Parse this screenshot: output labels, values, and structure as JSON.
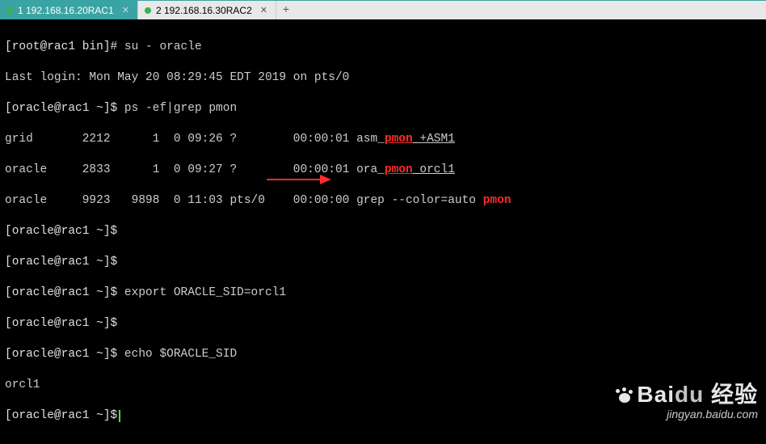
{
  "tabs": [
    {
      "label": "1 192.168.16.20RAC1",
      "active": true
    },
    {
      "label": "2 192.168.16.30RAC2",
      "active": false
    }
  ],
  "lines": {
    "l0_prompt": "[root@rac1 bin]#",
    "l0_cmd": " su - oracle",
    "l1": "Last login: Mon May 20 08:29:45 EDT 2019 on pts/0",
    "l2_prompt": "[oracle@rac1 ~]$",
    "l2_cmd": " ps -ef|grep pmon",
    "l3_pre": "grid       2212      1  0 09:26 ?        00:00:01 asm_",
    "l3_hi": "pmon",
    "l3_post": "_+ASM1",
    "l4_pre": "oracle     2833      1  0 09:27 ?        00:00:01 ora_",
    "l4_hi": "pmon",
    "l4_post": "_orcl1",
    "l5_pre": "oracle     9923   9898  0 11:03 pts/0    00:00:00 grep --color=auto ",
    "l5_hi": "pmon",
    "l6_prompt": "[oracle@rac1 ~]$",
    "l7_prompt": "[oracle@rac1 ~]$",
    "l8_prompt": "[oracle@rac1 ~]$",
    "l8_cmd": " export ORACLE_SID=orcl1",
    "l9_prompt": "[oracle@rac1 ~]$",
    "l10_prompt": "[oracle@rac1 ~]$",
    "l10_cmd": " echo $ORACLE_SID",
    "l11": "orcl1",
    "l12_prompt": "[oracle@rac1 ~]$"
  },
  "watermark": {
    "brand": "Bai",
    "brand2": "du",
    "slogan": "经验",
    "url": "jingyan.baidu.com"
  }
}
